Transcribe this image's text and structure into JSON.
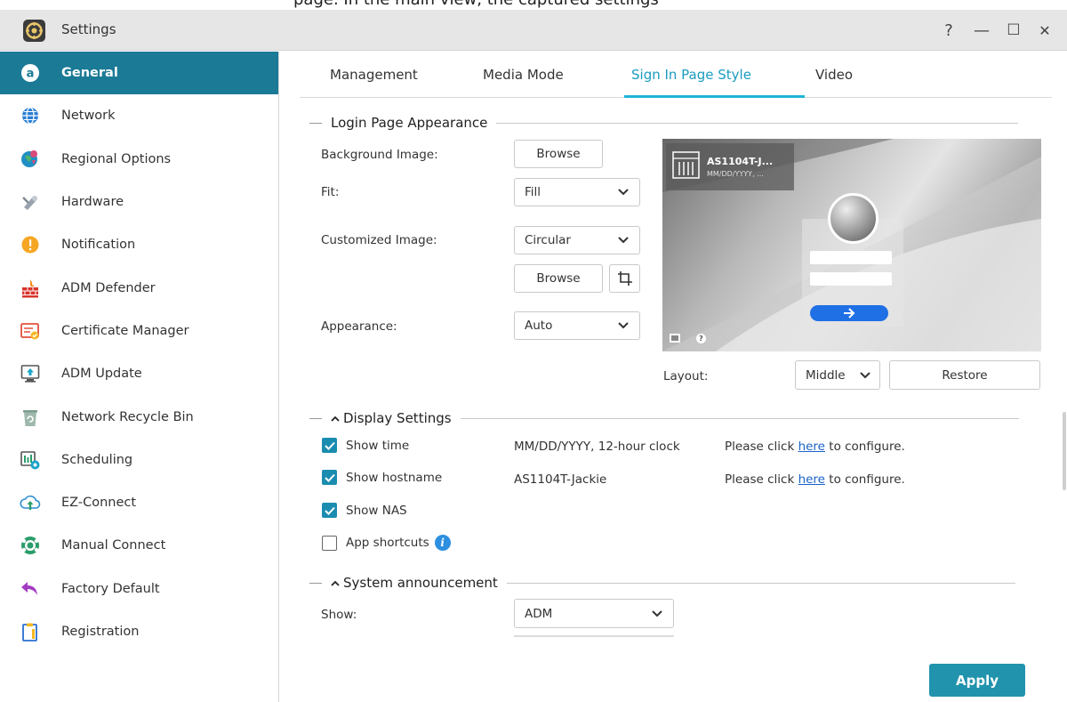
{
  "banner": {
    "text": "page. In the main view, the captured settings"
  },
  "window": {
    "title": "Settings",
    "controls": {
      "help": "?",
      "minimize": "—",
      "maximize": "☐",
      "close": "✕"
    }
  },
  "sidebar": {
    "items": [
      {
        "label": "General",
        "icon": "general-icon",
        "active": true
      },
      {
        "label": "Network",
        "icon": "globe-icon"
      },
      {
        "label": "Regional Options",
        "icon": "regional-icon"
      },
      {
        "label": "Hardware",
        "icon": "hardware-icon"
      },
      {
        "label": "Notification",
        "icon": "notification-icon"
      },
      {
        "label": "ADM Defender",
        "icon": "firewall-icon"
      },
      {
        "label": "Certificate Manager",
        "icon": "certificate-icon"
      },
      {
        "label": "ADM Update",
        "icon": "update-icon"
      },
      {
        "label": "Network Recycle Bin",
        "icon": "recycle-bin-icon"
      },
      {
        "label": "Scheduling",
        "icon": "scheduling-icon"
      },
      {
        "label": "EZ-Connect",
        "icon": "cloud-upload-icon"
      },
      {
        "label": "Manual Connect",
        "icon": "manual-connect-icon"
      },
      {
        "label": "Factory Default",
        "icon": "undo-icon"
      },
      {
        "label": "Registration",
        "icon": "clipboard-icon"
      }
    ]
  },
  "tabs": [
    {
      "label": "Management"
    },
    {
      "label": "Media Mode"
    },
    {
      "label": "Sign In Page Style",
      "active": true
    },
    {
      "label": "Video"
    }
  ],
  "login_appearance": {
    "title": "Login Page Appearance",
    "background_image_label": "Background Image:",
    "browse_label": "Browse",
    "fit_label": "Fit:",
    "fit_value": "Fill",
    "customized_image_label": "Customized Image:",
    "customized_image_value": "Circular",
    "browse2_label": "Browse",
    "appearance_label": "Appearance:",
    "appearance_value": "Auto",
    "layout_label": "Layout:",
    "layout_value": "Middle",
    "restore_label": "Restore",
    "preview": {
      "hostname": "AS1104T-J...",
      "date": "MM/DD/YYYY, ...",
      "help_glyph": "?"
    }
  },
  "display_settings": {
    "title": "Display Settings",
    "show_time": {
      "label": "Show time",
      "checked": true,
      "value": "MM/DD/YYYY, 12-hour clock",
      "hint_pre": "Please click ",
      "hint_link": "here",
      "hint_post": " to configure."
    },
    "show_hostname": {
      "label": "Show hostname",
      "checked": true,
      "value": "AS1104T-Jackie",
      "hint_pre": "Please click ",
      "hint_link": "here",
      "hint_post": " to configure."
    },
    "show_nas": {
      "label": "Show NAS",
      "checked": true
    },
    "app_shortcuts": {
      "label": "App shortcuts",
      "checked": false,
      "info_glyph": "i"
    }
  },
  "system_announcement": {
    "title": "System announcement",
    "show_label": "Show:",
    "show_value": "ADM"
  },
  "footer": {
    "apply_label": "Apply"
  },
  "colors": {
    "accent": "#1b7a95",
    "tab_active": "#1a9cc0",
    "checkbox": "#1a8cb0",
    "apply": "#2193ad",
    "link": "#1a62c9"
  }
}
